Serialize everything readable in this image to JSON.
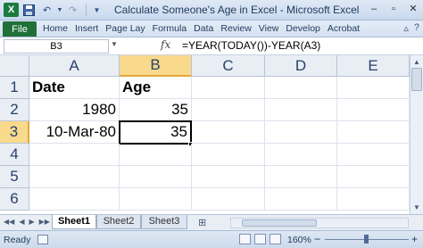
{
  "window": {
    "title": "Calculate Someone's Age in Excel - Microsoft Excel",
    "icons": [
      "excel-logo-icon",
      "save-icon",
      "undo-icon",
      "redo-icon",
      "customize-icon"
    ],
    "controls": {
      "minimize": "–",
      "restore": "▫",
      "close": "✕"
    }
  },
  "ribbon": {
    "file_label": "File",
    "tabs": [
      "Home",
      "Insert",
      "Page Lay",
      "Formula",
      "Data",
      "Review",
      "View",
      "Develop",
      "Acrobat"
    ]
  },
  "formula_bar": {
    "name_box": "B3",
    "fx": "fx",
    "formula": "=YEAR(TODAY())-YEAR(A3)"
  },
  "grid": {
    "columns": [
      "A",
      "B",
      "C",
      "D",
      "E"
    ],
    "rows": [
      "1",
      "2",
      "3",
      "4",
      "5",
      "6"
    ],
    "cells": {
      "A1": "Date",
      "B1": "Age",
      "A2": "1980",
      "B2": "35",
      "A3": "10-Mar-80",
      "B3": "35"
    },
    "active_cell": "B3"
  },
  "sheets": {
    "tabs": [
      "Sheet1",
      "Sheet2",
      "Sheet3"
    ],
    "active": "Sheet1"
  },
  "status_bar": {
    "status": "Ready",
    "zoom": "160%",
    "zoom_minus": "−",
    "zoom_plus": "+"
  },
  "colors": {
    "file_tab": "#20703a",
    "selected_header": "#f9d98c",
    "header": "#e9eef5"
  }
}
